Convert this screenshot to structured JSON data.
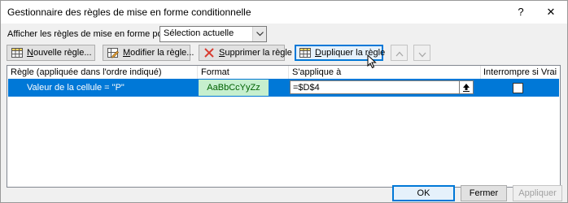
{
  "window": {
    "title": "Gestionnaire des règles de mise en forme conditionnelle",
    "help": "?",
    "close": "✕"
  },
  "filter": {
    "label": "Afficher les règles de mise en forme pour :",
    "selected": "Sélection actuelle"
  },
  "toolbar": {
    "new_rule_u": "N",
    "new_rule_rest": "ouvelle règle...",
    "edit_rule_u": "M",
    "edit_rule_rest": "odifier la règle...",
    "delete_rule_u": "S",
    "delete_rule_rest": "upprimer la règle",
    "duplicate_rule_u": "D",
    "duplicate_rule_rest": "upliquer la règle"
  },
  "table": {
    "headers": {
      "rule": "Règle (appliquée dans l'ordre indiqué)",
      "format": "Format",
      "applies_to": "S'applique à",
      "stop_if_true": "Interrompre si Vrai"
    },
    "rows": [
      {
        "rule": "Valeur de la cellule = \"P\"",
        "format_preview": "AaBbCcYyZz",
        "applies_to": "=$D$4",
        "stop_if_true": false
      }
    ]
  },
  "footer": {
    "ok": "OK",
    "close": "Fermer",
    "apply": "Appliquer"
  },
  "colors": {
    "selection": "#0078d7",
    "format_fill": "#c6efce",
    "format_text": "#006100"
  }
}
